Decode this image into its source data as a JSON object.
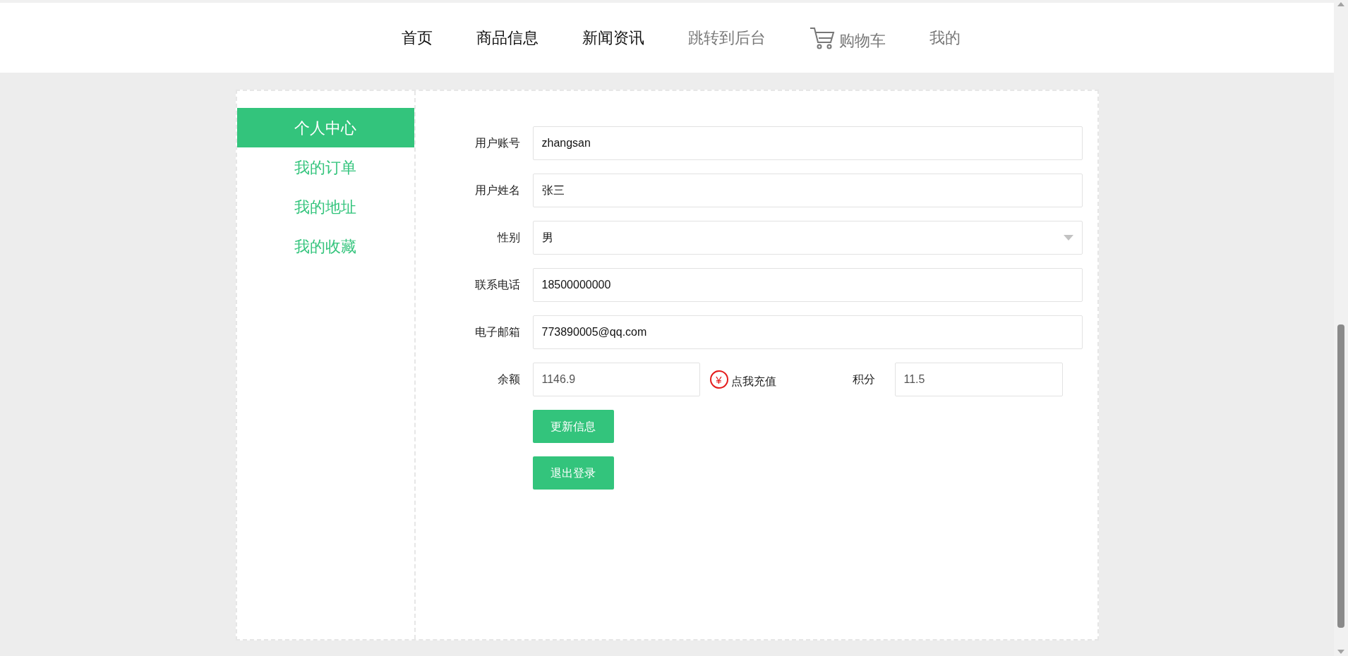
{
  "nav": [
    {
      "label": "首页",
      "kind": "link",
      "dimmed": false
    },
    {
      "label": "商品信息",
      "kind": "link",
      "dimmed": false
    },
    {
      "label": "新闻资讯",
      "kind": "link",
      "dimmed": false
    },
    {
      "label": "跳转到后台",
      "kind": "link",
      "dimmed": true
    },
    {
      "label": "购物车",
      "kind": "cart",
      "dimmed": true
    },
    {
      "label": "我的",
      "kind": "link",
      "dimmed": true
    }
  ],
  "sidebar": {
    "items": [
      {
        "label": "个人中心",
        "selected": true
      },
      {
        "label": "我的订单",
        "selected": false
      },
      {
        "label": "我的地址",
        "selected": false
      },
      {
        "label": "我的收藏",
        "selected": false
      }
    ]
  },
  "form": {
    "fields": [
      {
        "label": "用户账号",
        "kind": "input",
        "value": "zhangsan"
      },
      {
        "label": "用户姓名",
        "kind": "input",
        "value": "张三"
      },
      {
        "label": "性别",
        "kind": "select",
        "value": "男"
      },
      {
        "label": "联系电话",
        "kind": "input",
        "value": "18500000000"
      },
      {
        "label": "电子邮箱",
        "kind": "input",
        "value": "773890005@qq.com"
      }
    ],
    "balance": {
      "label": "余额",
      "value": "1146.9",
      "recharge_icon": "¥",
      "recharge": "点我充值"
    },
    "points": {
      "label": "积分",
      "value": "11.5"
    },
    "buttons": [
      "更新信息",
      "退出登录"
    ]
  }
}
